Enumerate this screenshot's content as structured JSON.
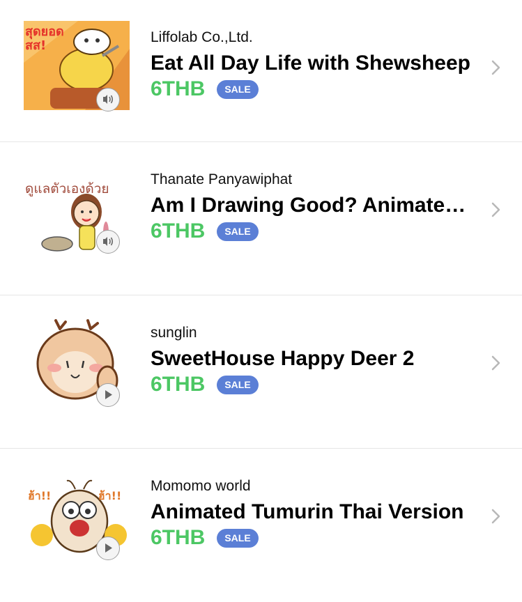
{
  "items": [
    {
      "author": "Liffolab Co.,Ltd.",
      "title": "Eat All Day Life with Shewsheep",
      "price": "6THB",
      "badge": "SALE",
      "thumb_text": "สุดยอดสส!",
      "media_icon": "sound-icon",
      "bg": "#f4a442"
    },
    {
      "author": "Thanate Panyawiphat",
      "title": "Am I Drawing Good? Animated Stickers",
      "price": "6THB",
      "badge": "SALE",
      "thumb_text": "ดูแลตัวเองด้วย",
      "media_icon": "sound-icon",
      "bg": "#ffffff"
    },
    {
      "author": "sunglin",
      "title": "SweetHouse Happy Deer 2",
      "price": "6THB",
      "badge": "SALE",
      "thumb_text": "",
      "media_icon": "play-icon",
      "bg": "#ffffff"
    },
    {
      "author": "Momomo world",
      "title": "Animated Tumurin Thai Version",
      "price": "6THB",
      "badge": "SALE",
      "thumb_text": "ฮ้า!! ฮ้า!!",
      "media_icon": "play-icon",
      "bg": "#ffffff"
    }
  ],
  "colors": {
    "price": "#4cc764",
    "badge_bg": "#5b7fd6",
    "separator": "#e6e6e6",
    "chevron": "#b8b8b8"
  }
}
